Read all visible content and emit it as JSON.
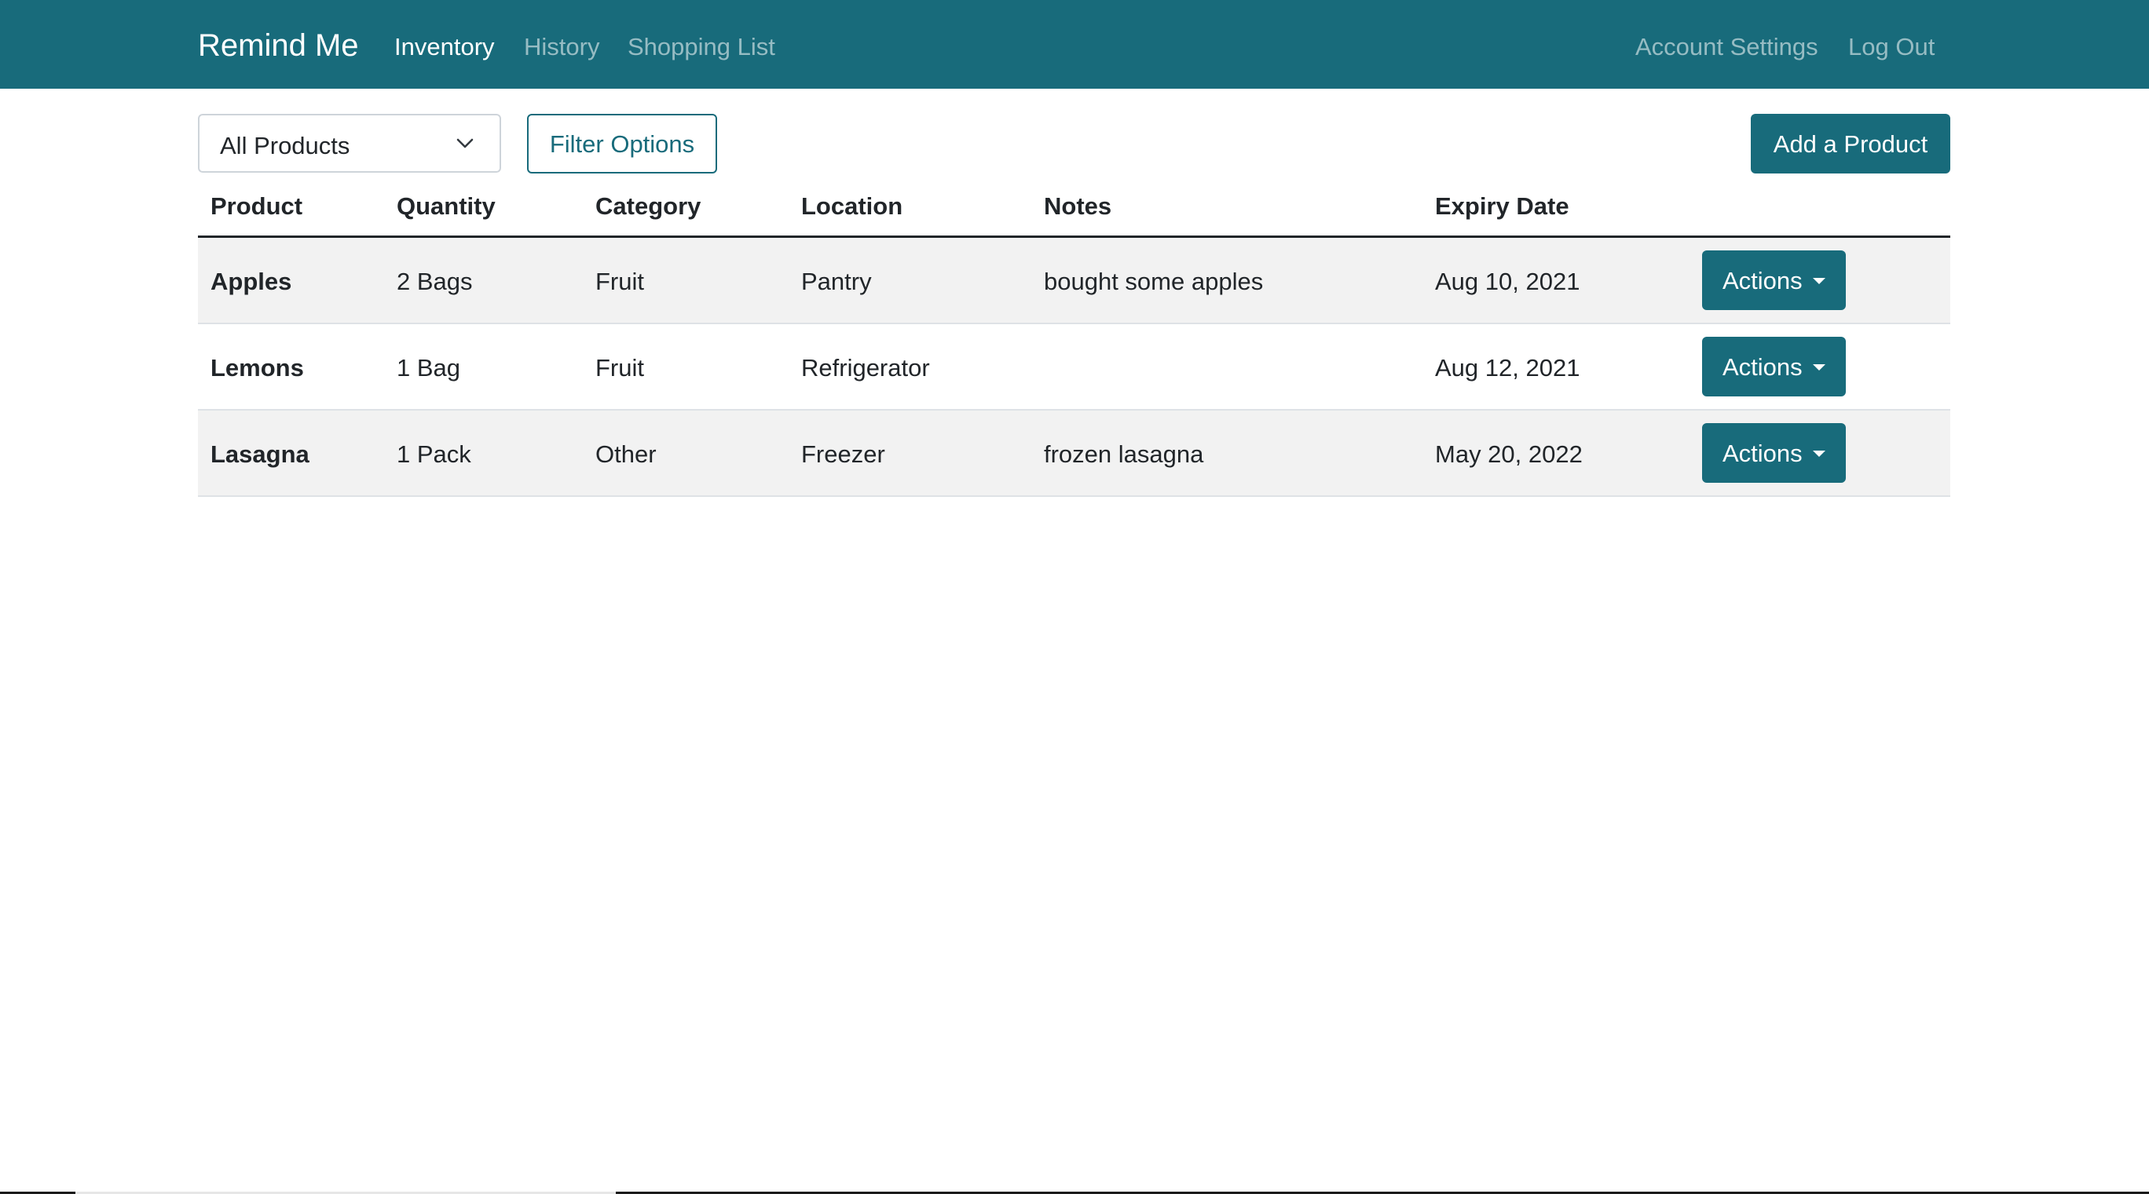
{
  "navbar": {
    "brand": "Remind Me",
    "links": [
      {
        "label": "Inventory",
        "active": true
      },
      {
        "label": "History",
        "active": false
      },
      {
        "label": "Shopping List",
        "active": false
      }
    ],
    "right_links": [
      "Account Settings",
      "Log Out"
    ]
  },
  "toolbar": {
    "filter_select": {
      "value": "All Products"
    },
    "filter_button": "Filter Options",
    "add_button": "Add a Product"
  },
  "table": {
    "headers": [
      "Product",
      "Quantity",
      "Category",
      "Location",
      "Notes",
      "Expiry Date"
    ],
    "rows": [
      {
        "product": "Apples",
        "quantity": "2 Bags",
        "category": "Fruit",
        "location": "Pantry",
        "notes": "bought some apples",
        "expiry": "Aug 10, 2021",
        "actions": "Actions"
      },
      {
        "product": "Lemons",
        "quantity": "1 Bag",
        "category": "Fruit",
        "location": "Refrigerator",
        "notes": "",
        "expiry": "Aug 12, 2021",
        "actions": "Actions"
      },
      {
        "product": "Lasagna",
        "quantity": "1 Pack",
        "category": "Other",
        "location": "Freezer",
        "notes": "frozen lasagna",
        "expiry": "May 20, 2022",
        "actions": "Actions"
      }
    ]
  },
  "icons": {
    "select": "chevron-down-icon",
    "actions": "caret-down-icon"
  },
  "colors": {
    "primary": "#186b7b",
    "stripe": "#f2f2f2",
    "text": "#212529"
  }
}
